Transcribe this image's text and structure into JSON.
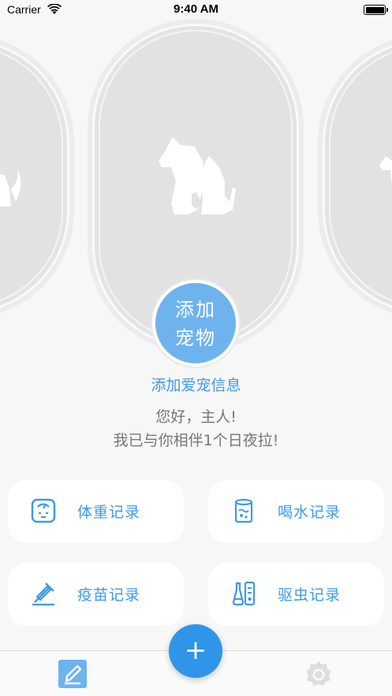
{
  "status_bar": {
    "carrier": "Carrier",
    "time": "9:40 AM"
  },
  "pet": {
    "add_button_label": "添加\n宠物",
    "add_button_line1": "添加",
    "add_button_line2": "宠物",
    "add_info_link": "添加爱宠信息",
    "greeting_line1": "您好，主人!",
    "greeting_line2": "我已与你相伴1个日夜拉!"
  },
  "records": [
    {
      "label": "体重记录",
      "icon": "scale-icon"
    },
    {
      "label": "喝水记录",
      "icon": "water-cup-icon"
    },
    {
      "label": "疫苗记录",
      "icon": "syringe-icon"
    },
    {
      "label": "驱虫记录",
      "icon": "spray-bottle-icon"
    }
  ],
  "tab_bar": {
    "fab_label": "+",
    "home_icon": "edit-icon",
    "settings_icon": "gear-icon"
  },
  "colors": {
    "accent": "#3d9ae6",
    "fab": "#2f95e8",
    "add_pet_button": "#6eb3ee",
    "card_bg": "#e4e4e4",
    "page_bg": "#f7f7f7"
  }
}
